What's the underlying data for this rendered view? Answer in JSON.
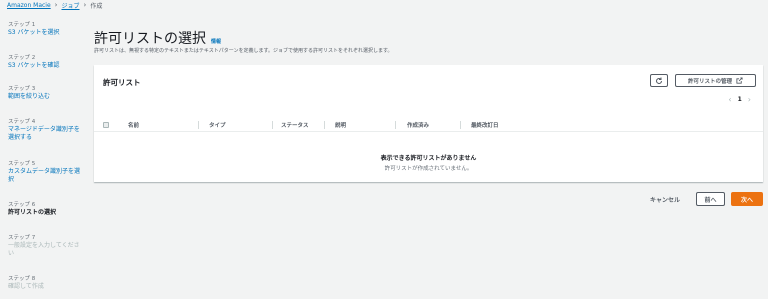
{
  "breadcrumb": {
    "items": [
      "Amazon Macie",
      "ジョブ",
      "作成"
    ]
  },
  "sidebar": {
    "steps": [
      {
        "num": "ステップ 1",
        "label": "S3 バケットを選択",
        "state": "link"
      },
      {
        "num": "ステップ 2",
        "label": "S3 バケットを確認",
        "state": "link"
      },
      {
        "num": "ステップ 3",
        "label": "範囲を絞り込む",
        "state": "link"
      },
      {
        "num": "ステップ 4",
        "label_lines": [
          "マネージドデータ識別子を",
          "選択する"
        ],
        "state": "link"
      },
      {
        "num": "ステップ 5",
        "label_lines": [
          "カスタムデータ識別子を選",
          "択"
        ],
        "state": "link"
      },
      {
        "num": "ステップ 6",
        "label": "許可リストの選択",
        "state": "active"
      },
      {
        "num": "ステップ 7",
        "label_lines": [
          "一般設定を入力してくださ",
          "い"
        ],
        "state": "disabled"
      },
      {
        "num": "ステップ 8",
        "label": "確認して作成",
        "state": "disabled"
      }
    ]
  },
  "page": {
    "title": "許可リストの選択",
    "info": "情報",
    "description": "許可リストは、無視する特定のテキストまたはテキストパターンを定義します。ジョブで使用する許可リストをそれぞれ選択します。"
  },
  "panel": {
    "title": "許可リスト",
    "manage_label": "許可リストの管理",
    "pager_page": "1",
    "columns": [
      "名前",
      "タイプ",
      "ステータス",
      "説明",
      "作成済み",
      "最終改訂日"
    ],
    "empty_title": "表示できる許可リストがありません",
    "empty_subtitle": "許可リストが作成されていません。"
  },
  "footer": {
    "cancel": "キャンセル",
    "prev": "前へ",
    "next": "次へ"
  },
  "colors": {
    "accent": "#ec7211",
    "link": "#0073bb"
  }
}
